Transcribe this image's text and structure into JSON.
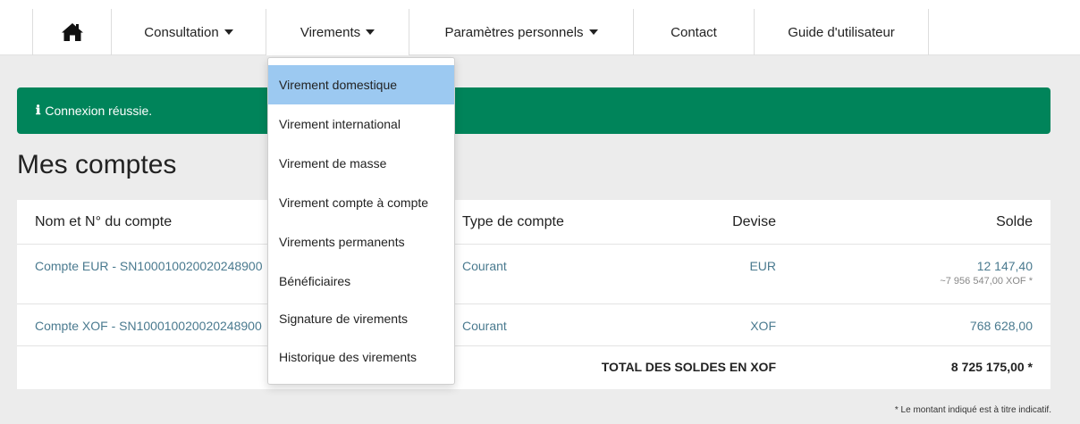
{
  "nav": {
    "home_icon": "home-icon",
    "items": [
      {
        "label": "Consultation"
      },
      {
        "label": "Virements"
      },
      {
        "label": "Paramètres personnels"
      },
      {
        "label": "Contact"
      },
      {
        "label": "Guide d'utilisateur"
      }
    ]
  },
  "alert": {
    "icon": "ℹ",
    "text": "Connexion réussie.",
    "color": "#00845a"
  },
  "page_title": "Mes comptes",
  "table": {
    "headers": [
      "Nom et N° du compte",
      "Type de compte",
      "Devise",
      "Solde"
    ],
    "rows": [
      {
        "name": "Compte EUR - SN100010020020248900",
        "type": "Courant",
        "currency": "EUR",
        "balance": "12 147,40",
        "sub": "~7 956 547,00 XOF *"
      },
      {
        "name": "Compte XOF - SN100010020020248900",
        "type": "Courant",
        "currency": "XOF",
        "balance": "768 628,00"
      }
    ],
    "total_label": "TOTAL DES SOLDES EN XOF",
    "total_value": "8 725 175,00 *"
  },
  "footnote": "* Le montant indiqué est à titre indicatif.",
  "dropdown": {
    "items": [
      "Virement domestique",
      "Virement international",
      "Virement de masse",
      "Virement compte à compte",
      "Virements permanents",
      "Bénéficiaires",
      "Signature de virements",
      "Historique des virements"
    ],
    "highlight_color": "#9cc9f1"
  }
}
